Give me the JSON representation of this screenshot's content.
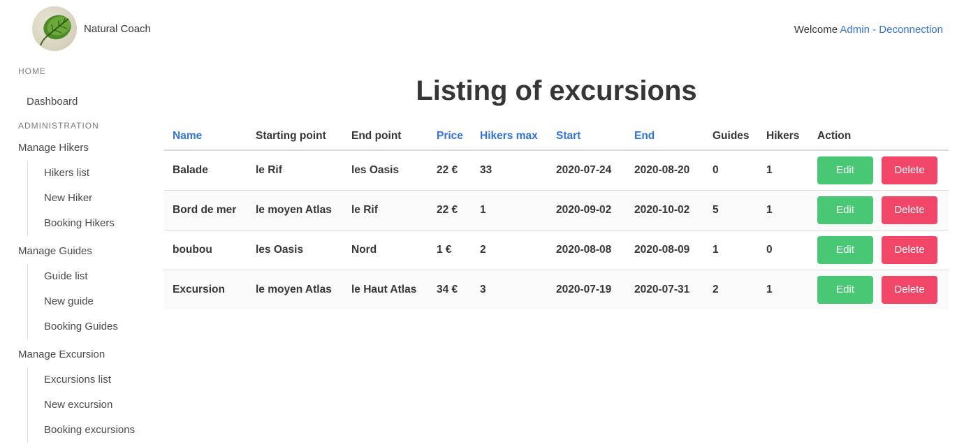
{
  "brand": {
    "name": "Natural Coach",
    "logo_icon": "leaf-icon"
  },
  "userbar": {
    "welcome": "Welcome ",
    "user": "Admin",
    "separator": " - ",
    "logout": "Deconnection"
  },
  "menu": {
    "home_label": "Home",
    "dashboard": "Dashboard",
    "admin_label": "Administration",
    "groups": [
      {
        "label": "Manage Hikers",
        "items": [
          "Hikers list",
          "New Hiker",
          "Booking Hikers"
        ]
      },
      {
        "label": "Manage Guides",
        "items": [
          "Guide list",
          "New guide",
          "Booking Guides"
        ]
      },
      {
        "label": "Manage Excursion",
        "items": [
          "Excursions list",
          "New excursion",
          "Booking excursions"
        ]
      }
    ]
  },
  "page": {
    "title": "Listing of excursions"
  },
  "table": {
    "headers": [
      "Name",
      "Starting point",
      "End point",
      "Price",
      "Hikers max",
      "Start",
      "End",
      "Guides",
      "Hikers",
      "Action"
    ],
    "rows": [
      [
        "Balade",
        "le Rif",
        "les Oasis",
        "22 €",
        "33",
        "2020-07-24",
        "2020-08-20",
        "0",
        "1"
      ],
      [
        "Bord de mer",
        "le moyen Atlas",
        "le Rif",
        "22 €",
        "1",
        "2020-09-02",
        "2020-10-02",
        "5",
        "1"
      ],
      [
        "boubou",
        "les Oasis",
        "Nord",
        "1 €",
        "2",
        "2020-08-08",
        "2020-08-09",
        "1",
        "0"
      ],
      [
        "Excursion",
        "le moyen Atlas",
        "le Haut Atlas",
        "34 €",
        "3",
        "2020-07-19",
        "2020-07-31",
        "2",
        "1"
      ]
    ],
    "edit_label": "Edit",
    "delete_label": "Delete"
  },
  "colors": {
    "link": "#3273dc",
    "edit": "#48c774",
    "delete": "#f14668"
  }
}
